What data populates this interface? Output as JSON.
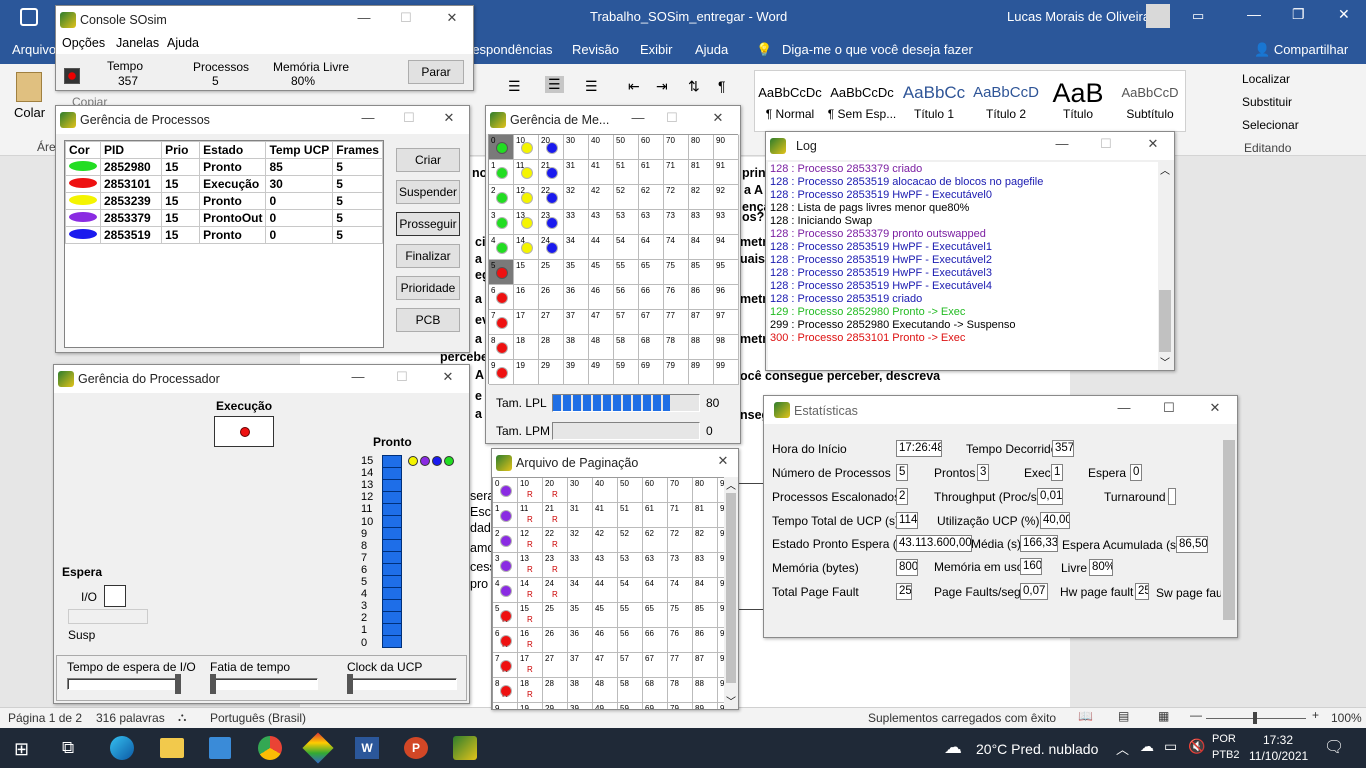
{
  "word": {
    "title": "Trabalho_SOSim_entregar  -  Word",
    "user": "Lucas Morais de Oliveira",
    "menu": [
      "Arquivo",
      "respondências",
      "Revisão",
      "Exibir",
      "Ajuda"
    ],
    "tell_me": "Diga-me o que você deseja fazer",
    "share": "Compartilhar",
    "paste": "Colar",
    "copy": "Copiar",
    "area": "Áre",
    "styles": [
      {
        "preview": "AaBbCcDc",
        "name": "¶ Normal"
      },
      {
        "preview": "AaBbCcDc",
        "name": "¶ Sem Esp..."
      },
      {
        "preview": "AaBbCc",
        "name": "Título 1"
      },
      {
        "preview": "AaBbCcD",
        "name": "Título 2"
      },
      {
        "preview": "AaB",
        "name": "Título"
      },
      {
        "preview": "AaBbCcD",
        "name": "Subtítulo"
      }
    ],
    "edit": [
      "Localizar",
      "Substituir",
      "Selecionar"
    ],
    "edit_group": "Editando",
    "doc_fragments": [
      "no",
      "prin",
      "a A",
      "ença",
      "os?",
      "cie",
      "metr",
      "a A",
      "uais",
      "egu",
      "a",
      "metr",
      "ev",
      "a",
      "metr",
      "perceber",
      "A",
      "ocê consegue perceber, descreva",
      "e",
      "a",
      "nseg",
      "sera",
      "Esca",
      "dada",
      "amo",
      "cess",
      "pro"
    ],
    "status": {
      "page": "Página 1 de 2",
      "words": "316 palavras",
      "lang": "Português (Brasil)",
      "addins": "Suplementos carregados com êxito",
      "zoom": "100%"
    }
  },
  "taskbar": {
    "weather": "20°C  Pred. nublado",
    "lang1": "POR",
    "lang2": "PTB2",
    "time": "17:32",
    "date": "11/10/2021"
  },
  "console": {
    "title": "Console SOsim",
    "menu": [
      "Opções",
      "Janelas",
      "Ajuda"
    ],
    "tempo_label": "Tempo",
    "tempo": "357",
    "proc_label": "Processos",
    "proc": "5",
    "mem_label": "Memória Livre",
    "mem": "80%",
    "stop": "Parar"
  },
  "gerencia_proc": {
    "title": "Gerência de Processos",
    "headers": [
      "Cor",
      "PID",
      "Prio",
      "Estado",
      "Temp UCP",
      "Frames"
    ],
    "rows": [
      {
        "color": "#22dd22",
        "pid": "2852980",
        "prio": "15",
        "estado": "Pronto",
        "ucp": "85",
        "frames": "5"
      },
      {
        "color": "#ee1111",
        "pid": "2853101",
        "prio": "15",
        "estado": "Execução",
        "ucp": "30",
        "frames": "5"
      },
      {
        "color": "#f4f400",
        "pid": "2853239",
        "prio": "15",
        "estado": "Pronto",
        "ucp": "0",
        "frames": "5"
      },
      {
        "color": "#8a2be2",
        "pid": "2853379",
        "prio": "15",
        "estado": "ProntoOut",
        "ucp": "0",
        "frames": "5"
      },
      {
        "color": "#1a1aee",
        "pid": "2853519",
        "prio": "15",
        "estado": "Pronto",
        "ucp": "0",
        "frames": "5"
      }
    ],
    "buttons": [
      "Criar",
      "Suspender",
      "Prosseguir",
      "Finalizar",
      "Prioridade",
      "PCB"
    ]
  },
  "gerencia_cpu": {
    "title": "Gerência do Processador",
    "exec_label": "Execução",
    "pronto_label": "Pronto",
    "espera_label": "Espera",
    "io_label": "I/O",
    "susp_label": "Susp",
    "levels": [
      "15",
      "14",
      "13",
      "12",
      "11",
      "10",
      "9",
      "8",
      "7",
      "6",
      "5",
      "4",
      "3",
      "2",
      "1",
      "0"
    ],
    "ready_colors": [
      "#f4f400",
      "#8a2be2",
      "#1a1aee",
      "#22dd22"
    ],
    "exec_color": "#ee1111",
    "sliders": [
      "Tempo de espera de I/O",
      "Fatia de tempo",
      "Clock da UCP"
    ]
  },
  "gerencia_mem": {
    "title": "Gerência de Me...",
    "cols": [
      "0",
      "10",
      "20",
      "30",
      "40",
      "50",
      "60",
      "70",
      "80",
      "90"
    ],
    "lpl_label": "Tam. LPL",
    "lpl": "80",
    "lpl_fill": 0.8,
    "lpm_label": "Tam. LPM",
    "lpm": "0",
    "lpm_fill": 0
  },
  "paginacao": {
    "title": "Arquivo de Paginação"
  },
  "log": {
    "title": "Log",
    "lines": [
      {
        "t": "128 : Processo 2853379 criado",
        "c": "#7b1fa2"
      },
      {
        "t": "128 : Processo 2853519 alocacao de blocos no pagefile",
        "c": "#1a1ab0"
      },
      {
        "t": "128 : Processo 2853519 HwPF - Executável0",
        "c": "#1a1ab0"
      },
      {
        "t": "128 : Lista de pags livres menor que80%",
        "c": "#000"
      },
      {
        "t": "128 : Iniciando Swap",
        "c": "#000"
      },
      {
        "t": "128 : Processo 2853379 pronto outswapped",
        "c": "#7b1fa2"
      },
      {
        "t": "128 : Processo 2853519 HwPF - Executável1",
        "c": "#1a1ab0"
      },
      {
        "t": "128 : Processo 2853519 HwPF - Executável2",
        "c": "#1a1ab0"
      },
      {
        "t": "128 : Processo 2853519 HwPF - Executável3",
        "c": "#1a1ab0"
      },
      {
        "t": "128 : Processo 2853519 HwPF - Executável4",
        "c": "#1a1ab0"
      },
      {
        "t": "128 : Processo 2853519 criado",
        "c": "#1a1ab0"
      },
      {
        "t": "129 : Processo 2852980 Pronto -> Exec",
        "c": "#22bb22"
      },
      {
        "t": "299 : Processo 2852980 Executando -> Suspenso",
        "c": "#000"
      },
      {
        "t": "300 : Processo 2853101 Pronto -> Exec",
        "c": "#dd1111"
      }
    ]
  },
  "estat": {
    "title": "Estatísticas",
    "hora_inicio_l": "Hora do Início",
    "hora_inicio": "17:26:48",
    "tempo_dec_l": "Tempo Decorrido",
    "tempo_dec": "357",
    "num_proc_l": "Número de Processos",
    "num_proc": "5",
    "prontos_l": "Prontos",
    "prontos": "3",
    "exec_l": "Exec",
    "exec": "1",
    "espera_l": "Espera",
    "espera": "0",
    "esc_l": "Processos Escalonados",
    "esc": "2",
    "thr_l": "Throughput (Proc/s)",
    "thr": "0,01",
    "turn_l": "Turnaround",
    "turn": "",
    "ucp_total_l": "Tempo Total de UCP (s)",
    "ucp_total": "114",
    "ucp_util_l": "Utilização UCP (%)",
    "ucp_util": "40,00",
    "pronto_esp_l": "Estado Pronto Espera (s)",
    "pronto_esp": "43.113.600,00",
    "media_l": "Média (s)",
    "media": "166,33",
    "esp_acum_l": "Espera Acumulada (s)",
    "esp_acum": "86,50",
    "mem_l": "Memória (bytes)",
    "mem": "800",
    "mem_uso_l": "Memória em uso",
    "mem_uso": "160",
    "livre_l": "Livre",
    "livre": "80%",
    "pf_total_l": "Total Page Fault",
    "pf_total": "25",
    "pf_seg_l": "Page Faults/seg",
    "pf_seg": "0,07",
    "hw_l": "Hw page fault",
    "hw": "25",
    "sw_l": "Sw page fault"
  }
}
